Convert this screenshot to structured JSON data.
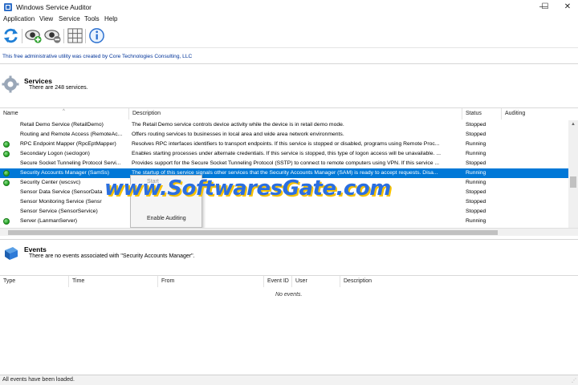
{
  "window": {
    "title": "Windows Service Auditor",
    "minimize": "—",
    "maximize": "☐",
    "close": "✕"
  },
  "menu": [
    "Application",
    "View",
    "Service",
    "Tools",
    "Help"
  ],
  "banner": "This free administrative utility was created by Core Technologies Consulting, LLC",
  "services": {
    "title": "Services",
    "count": "There are 248 services.",
    "columns": {
      "name": "Name",
      "description": "Description",
      "status": "Status",
      "auditing": "Auditing"
    },
    "rows": [
      {
        "running": false,
        "name": "Retail Demo Service (RetailDemo)",
        "description": "The Retail Demo service controls device activity while the device is in retail demo mode.",
        "status": "Stopped"
      },
      {
        "running": false,
        "name": "Routing and Remote Access (RemoteAc...",
        "description": "Offers routing services to businesses in local area and wide area network environments.",
        "status": "Stopped"
      },
      {
        "running": true,
        "name": "RPC Endpoint Mapper (RpcEptMapper)",
        "description": "Resolves RPC interfaces identifiers to transport endpoints. If this service is stopped or disabled, programs using Remote Proc...",
        "status": "Running"
      },
      {
        "running": true,
        "name": "Secondary Logon (seclogon)",
        "description": "Enables starting processes under alternate credentials. If this service is stopped, this type of logon access will be unavailable. ...",
        "status": "Running"
      },
      {
        "running": false,
        "name": "Secure Socket Tunneling Protocol Servi...",
        "description": "Provides support for the Secure Socket Tunneling Protocol (SSTP) to connect to remote computers using VPN. If this service ...",
        "status": "Stopped"
      },
      {
        "running": true,
        "selected": true,
        "name": "Security Accounts Manager (SamSs)",
        "description": "The startup of this service signals other services that the Security Accounts Manager (SAM) is ready to accept requests. Disa...",
        "status": "Running"
      },
      {
        "running": true,
        "name": "Security Center (wscsvc)",
        "description": "",
        "status": "Running"
      },
      {
        "running": false,
        "name": "Sensor Data Service (SensorData",
        "description": "",
        "status": "Stopped"
      },
      {
        "running": false,
        "name": "Sensor Monitoring Service (Sensr",
        "description": "",
        "status": "Stopped"
      },
      {
        "running": false,
        "name": "Sensor Service (SensorService)",
        "description": "",
        "status": "Stopped"
      },
      {
        "running": true,
        "name": "Server (LanmanServer)",
        "description": "",
        "status": "Running"
      }
    ]
  },
  "context_menu": {
    "start": "Start",
    "enable_auditing": "Enable Auditing"
  },
  "watermark": "www.SoftwaresGate.com",
  "events": {
    "title": "Events",
    "subtitle": "There are no events associated with \"Security Accounts Manager\".",
    "columns": {
      "type": "Type",
      "time": "Time",
      "from": "From",
      "event_id": "Event ID",
      "user": "User",
      "description": "Description"
    },
    "empty": "No events."
  },
  "statusbar": "All events have been loaded.",
  "colors": {
    "selection": "#0078d7",
    "banner_text": "#003399",
    "running_dot": "#1e9e1e"
  }
}
